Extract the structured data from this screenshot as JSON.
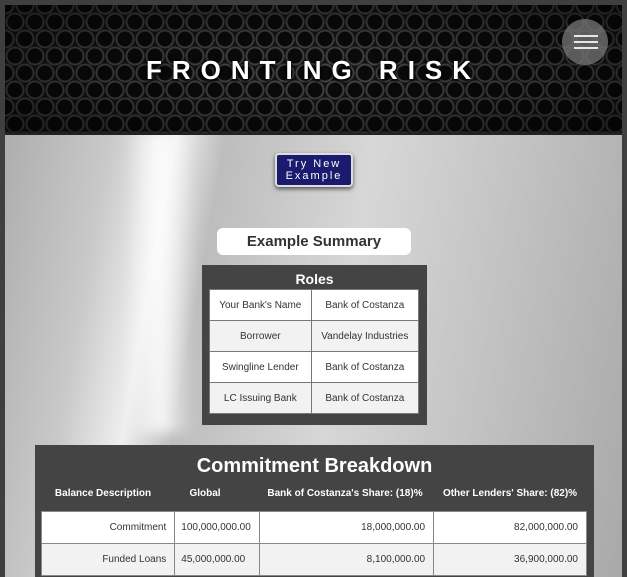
{
  "header": {
    "title": "FRONTING RISK",
    "menu_icon": "hamburger-icon"
  },
  "actions": {
    "try_new_line1": "Try New",
    "try_new_line2": "Example",
    "button_color": "#1a1a6e"
  },
  "summary": {
    "title": "Example Summary"
  },
  "roles": {
    "title": "Roles",
    "rows": [
      {
        "label": "Your Bank's Name",
        "value": "Bank of Costanza"
      },
      {
        "label": "Borrower",
        "value": "Vandelay Industries"
      },
      {
        "label": "Swingline Lender",
        "value": "Bank of Costanza"
      },
      {
        "label": "LC Issuing Bank",
        "value": "Bank of Costanza"
      }
    ]
  },
  "commitment": {
    "title": "Commitment Breakdown",
    "headers": [
      "Balance Description",
      "Global",
      "Bank of Costanza's Share: (18)%",
      "Other Lenders' Share: (82)%"
    ],
    "rows": [
      {
        "description": "Commitment",
        "global": "100,000,000.00",
        "bank_share": "18,000,000.00",
        "other_share": "82,000,000.00"
      },
      {
        "description": "Funded Loans",
        "global": "45,000,000.00",
        "bank_share": "8,100,000.00",
        "other_share": "36,900,000.00"
      }
    ]
  }
}
